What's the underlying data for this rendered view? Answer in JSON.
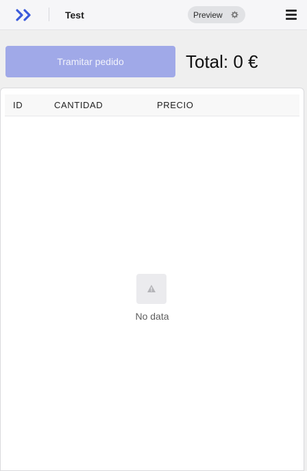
{
  "header": {
    "app_title": "Test",
    "preview_label": "Preview",
    "logo_icon": "double-chevron-logo",
    "settings_icon": "gear-icon",
    "menu_icon": "hamburger-menu-icon",
    "brand_color": "#3b5bdb"
  },
  "actions": {
    "submit_label": "Tramitar pedido",
    "submit_color": "#a0a9e8",
    "total_label": "Total: 0 €"
  },
  "table": {
    "columns": [
      "ID",
      "CANTIDAD",
      "PRECIO"
    ],
    "rows": [],
    "empty_icon": "warning-triangle-icon",
    "empty_text": "No data"
  }
}
